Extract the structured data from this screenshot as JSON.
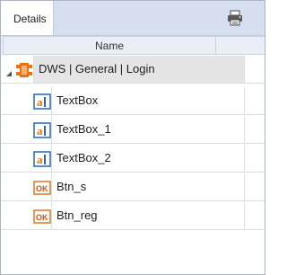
{
  "tabs": [
    {
      "label": "Details",
      "active": true
    }
  ],
  "toolbar": {
    "print_icon": "printer-icon"
  },
  "columns": [
    {
      "label": "Name"
    }
  ],
  "tree": {
    "root": {
      "label": "DWS | General | Login",
      "icon": "component-icon",
      "expanded": true
    },
    "children": [
      {
        "label": "TextBox",
        "icon": "textbox-icon"
      },
      {
        "label": "TextBox_1",
        "icon": "textbox-icon"
      },
      {
        "label": "TextBox_2",
        "icon": "textbox-icon"
      },
      {
        "label": "Btn_s",
        "icon": "button-ok-icon"
      },
      {
        "label": "Btn_reg",
        "icon": "button-ok-icon"
      }
    ]
  },
  "colors": {
    "accent": "#e8731a",
    "selected_row": "#e5e5e5",
    "tab_bar": "#d6dff0",
    "header": "#e9eef7"
  }
}
